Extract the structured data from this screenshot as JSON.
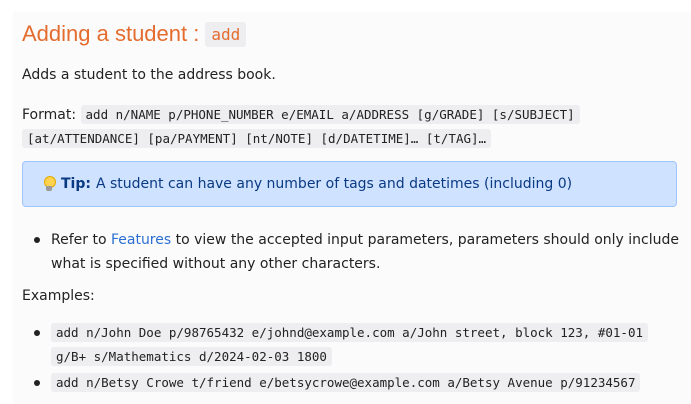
{
  "heading": {
    "text": "Adding a student :",
    "command": "add"
  },
  "description": "Adds a student to the address book.",
  "format": {
    "label": "Format:",
    "line1": "add n/NAME p/PHONE_NUMBER e/EMAIL a/ADDRESS [g/GRADE] [s/SUBJECT]",
    "line2": "[at/ATTENDANCE] [pa/PAYMENT] [nt/NOTE] [d/DATETIME]… [t/TAG]…"
  },
  "tip": {
    "icon": "lightbulb-icon",
    "label": "Tip:",
    "text": "A student can have any number of tags and datetimes (including 0)"
  },
  "note": {
    "prefix": "Refer to",
    "link": "Features",
    "suffix": "to view the accepted input parameters, parameters should only include what is specified without any other characters."
  },
  "examples": {
    "label": "Examples:",
    "items": [
      {
        "line1": "add n/John Doe p/98765432 e/johnd@example.com a/John street, block 123, #01-01",
        "line2": "g/B+ s/Mathematics d/2024-02-03 1800"
      },
      {
        "line1": "add n/Betsy Crowe t/friend e/betsycrowe@example.com a/Betsy Avenue p/91234567"
      }
    ]
  },
  "colors": {
    "heading": "#e46c2e",
    "tip_background": "#cfe2ff",
    "tip_text": "#0a3a82",
    "link": "#2a6fd1"
  }
}
